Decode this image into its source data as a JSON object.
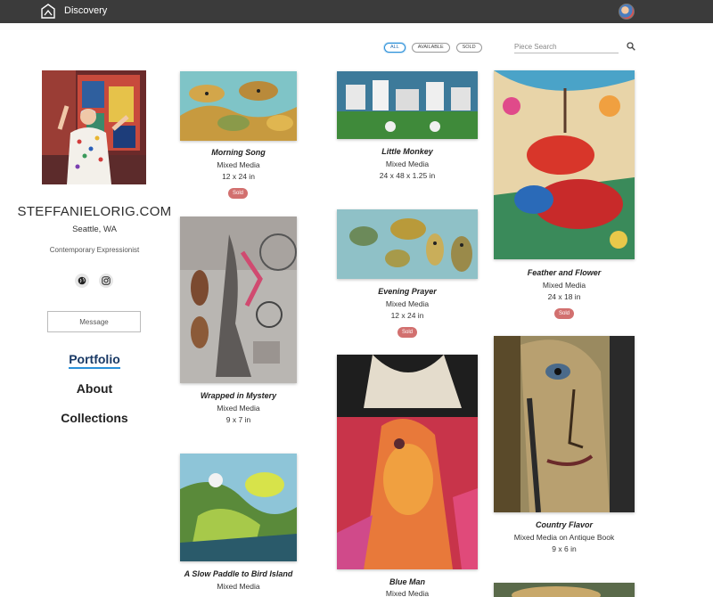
{
  "header": {
    "brand": "Discovery"
  },
  "filters": {
    "all": "ALL",
    "available": "AVAILABLE",
    "sold": "SOLD"
  },
  "search": {
    "placeholder": "Piece Search"
  },
  "profile": {
    "name": "STEFFANIELORIG.COM",
    "location": "Seattle, WA",
    "tagline": "Contemporary Expressionist",
    "message_label": "Message"
  },
  "nav": {
    "portfolio": "Portfolio",
    "about": "About",
    "collections": "Collections"
  },
  "artworks": [
    {
      "title": "Morning Song",
      "medium": "Mixed Media",
      "size": "12 x 24 in",
      "status": "Sold"
    },
    {
      "title": "Little Monkey",
      "medium": "Mixed Media",
      "size": "24 x 48 x 1.25 in"
    },
    {
      "title": "Feather and Flower",
      "medium": "Mixed Media",
      "size": "24 x 18 in",
      "status": "Sold"
    },
    {
      "title": "Wrapped in Mystery",
      "medium": "Mixed Media",
      "size": "9 x 7 in"
    },
    {
      "title": "Evening Prayer",
      "medium": "Mixed Media",
      "size": "12 x 24 in",
      "status": "Sold"
    },
    {
      "title": "Country Flavor",
      "medium": "Mixed Media on Antique Book",
      "size": "9 x 6 in"
    },
    {
      "title": "A Slow Paddle to Bird Island",
      "medium": "Mixed Media"
    },
    {
      "title": "Blue Man",
      "medium": "Mixed Media"
    }
  ],
  "colors": {
    "accent": "#2a90d9",
    "sold_badge": "#d2706f",
    "topbar": "#3b3b3b"
  }
}
